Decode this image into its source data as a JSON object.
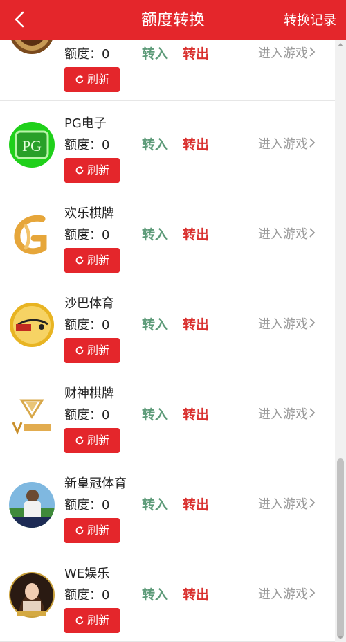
{
  "header": {
    "back_icon": "chevron-left-icon",
    "title": "额度转换",
    "record_label": "转换记录",
    "bg_color": "#e4262b"
  },
  "games": [
    {
      "name": "",
      "logo": "ag-logo-icon",
      "quota_label": "额度：",
      "quota_value": "0",
      "in_label": "转入",
      "out_label": "转出",
      "enter_label": "进入游戏",
      "refresh_label": "刷新"
    },
    {
      "name": "PG电子",
      "logo": "pg-logo-icon",
      "quota_label": "额度：",
      "quota_value": "0",
      "in_label": "转入",
      "out_label": "转出",
      "enter_label": "进入游戏",
      "refresh_label": "刷新"
    },
    {
      "name": "欢乐棋牌",
      "logo": "kg-logo-icon",
      "quota_label": "额度：",
      "quota_value": "0",
      "in_label": "转入",
      "out_label": "转出",
      "enter_label": "进入游戏",
      "refresh_label": "刷新"
    },
    {
      "name": "沙巴体育",
      "logo": "saba-logo-icon",
      "quota_label": "额度：",
      "quota_value": "0",
      "in_label": "转入",
      "out_label": "转出",
      "enter_label": "进入游戏",
      "refresh_label": "刷新"
    },
    {
      "name": "财神棋牌",
      "logo": "vg-logo-icon",
      "quota_label": "额度：",
      "quota_value": "0",
      "in_label": "转入",
      "out_label": "转出",
      "enter_label": "进入游戏",
      "refresh_label": "刷新"
    },
    {
      "name": "新皇冠体育",
      "logo": "crown-sports-logo-icon",
      "quota_label": "额度：",
      "quota_value": "0",
      "in_label": "转入",
      "out_label": "转出",
      "enter_label": "进入游戏",
      "refresh_label": "刷新"
    },
    {
      "name": "WE娱乐",
      "logo": "we-logo-icon",
      "quota_label": "额度：",
      "quota_value": "0",
      "in_label": "转入",
      "out_label": "转出",
      "enter_label": "进入游戏",
      "refresh_label": "刷新"
    }
  ],
  "colors": {
    "transfer_in": "#5d9b79",
    "transfer_out": "#d9312f",
    "enter_game": "#9a9a9a",
    "refresh_button": "#e4262b"
  }
}
